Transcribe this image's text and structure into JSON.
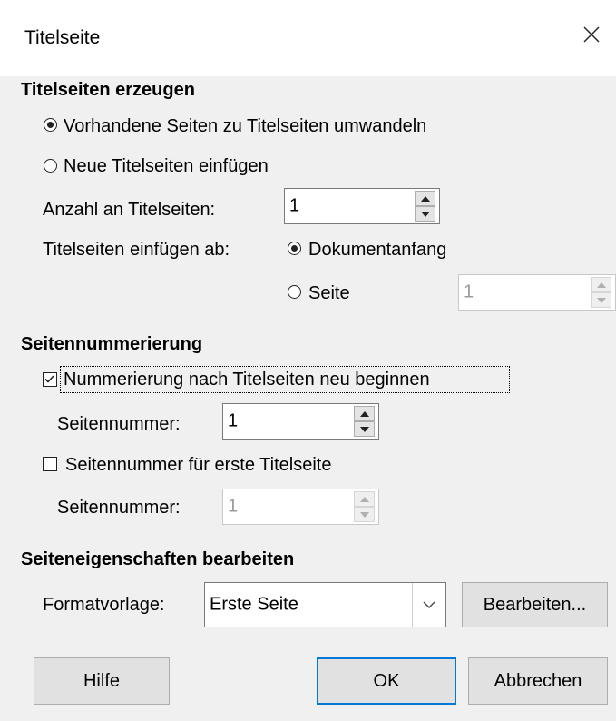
{
  "window": {
    "title": "Titelseite",
    "close_glyph": "✕"
  },
  "create": {
    "heading": "Titelseiten erzeugen",
    "convert_label": "Vorhandene Seiten zu Titelseiten umwandeln",
    "convert_checked": true,
    "insert_label": "Neue Titelseiten einfügen",
    "insert_checked": false,
    "count_label": "Anzahl an Titelseiten:",
    "count_value": "1",
    "insert_at_label": "Titelseiten einfügen ab:",
    "doc_start_label": "Dokumentanfang",
    "doc_start_checked": true,
    "page_label": "Seite",
    "page_checked": false,
    "page_value": "1"
  },
  "numbering": {
    "heading": "Seitennummerierung",
    "restart_label": "Nummerierung nach Titelseiten neu beginnen",
    "restart_checked": true,
    "restart_number_label": "Seitennummer:",
    "restart_number_value": "1",
    "first_number_label": "Seitennummer für erste Titelseite",
    "first_number_checked": false,
    "first_number_label2": "Seitennummer:",
    "first_number_value": "1"
  },
  "properties": {
    "heading": "Seiteneigenschaften bearbeiten",
    "style_label": "Formatvorlage:",
    "style_value": "Erste Seite",
    "edit_button": "Bearbeiten..."
  },
  "footer": {
    "help_button": "Hilfe",
    "ok_button": "OK",
    "cancel_button": "Abbrechen"
  },
  "colors": {
    "accent": "#0078d7",
    "background": "#f0f0f0",
    "titlebar": "#ffffff"
  },
  "icons": {
    "close": "close-icon",
    "spin_up": "spin-up-icon",
    "spin_down": "spin-down-icon",
    "dropdown": "chevron-down-icon",
    "checkmark": "checkmark-icon"
  }
}
